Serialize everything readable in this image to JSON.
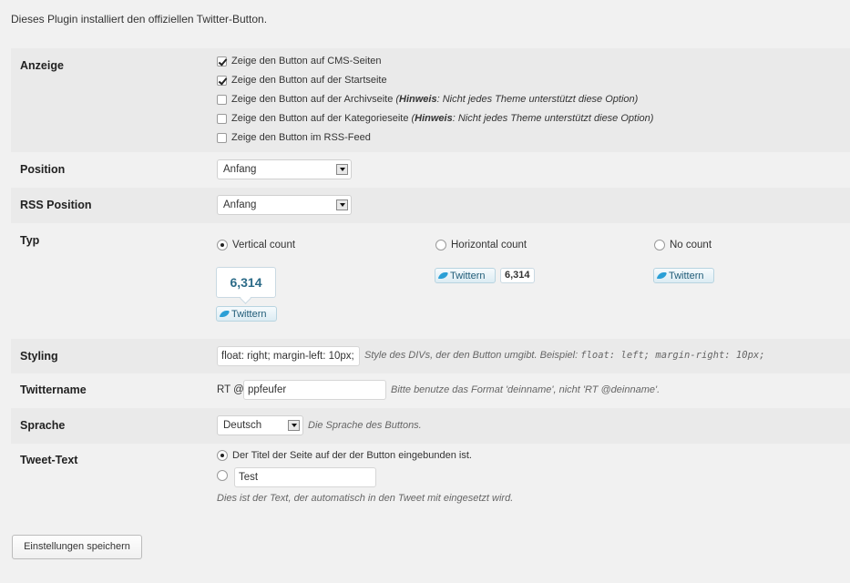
{
  "intro": "Dieses Plugin installiert den offiziellen Twitter-Button.",
  "anzeige": {
    "label": "Anzeige",
    "options": [
      {
        "text": "Zeige den Button auf CMS-Seiten",
        "checked": true
      },
      {
        "text": "Zeige den Button auf der Startseite",
        "checked": true
      },
      {
        "text": "Zeige den Button auf der Archivseite",
        "hint_bold": "Hinweis",
        "hint": ": Nicht jedes Theme unterstützt diese Option)",
        "checked": false
      },
      {
        "text": "Zeige den Button auf der Kategorieseite",
        "hint_bold": "Hinweis",
        "hint": ": Nicht jedes Theme unterstützt diese Option)",
        "checked": false
      },
      {
        "text": "Zeige den Button im RSS-Feed",
        "checked": false
      }
    ]
  },
  "position": {
    "label": "Position",
    "value": "Anfang"
  },
  "rss_position": {
    "label": "RSS Position",
    "value": "Anfang"
  },
  "typ": {
    "label": "Typ",
    "options": [
      {
        "label": "Vertical count",
        "checked": true
      },
      {
        "label": "Horizontal count",
        "checked": false
      },
      {
        "label": "No count",
        "checked": false
      }
    ],
    "preview_count": "6,314",
    "preview_button": "Twittern"
  },
  "styling": {
    "label": "Styling",
    "value": "float: right; margin-left: 10px;",
    "hint": "Style des DIVs, der den Button umgibt. Beispiel:",
    "example": "float: left; margin-right: 10px;"
  },
  "twittername": {
    "label": "Twittername",
    "prefix": "RT @",
    "value": "ppfeufer",
    "hint": "Bitte benutze das Format 'deinname', nicht 'RT @deinname'."
  },
  "sprache": {
    "label": "Sprache",
    "value": "Deutsch",
    "hint": "Die Sprache des Buttons."
  },
  "tweet_text": {
    "label": "Tweet-Text",
    "option_title": "Der Titel der Seite auf der der Button eingebunden ist.",
    "title_checked": true,
    "custom_value": "Test",
    "custom_checked": false,
    "hint": "Dies ist der Text, der automatisch in den Tweet mit eingesetzt wird."
  },
  "save_button": "Einstellungen speichern"
}
